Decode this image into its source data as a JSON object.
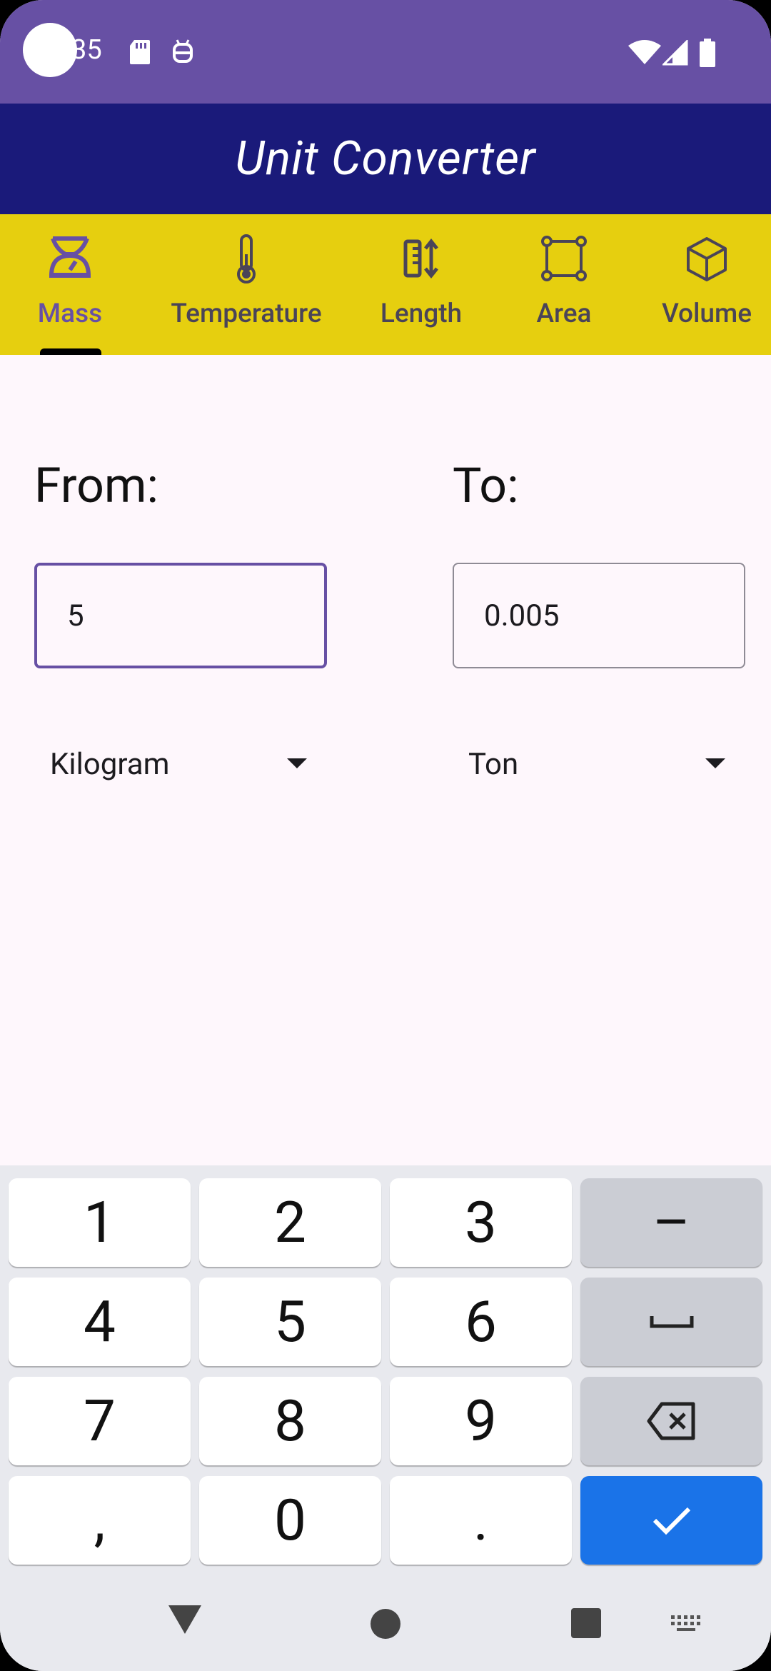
{
  "status_bar": {
    "time": "35"
  },
  "app_bar": {
    "title": "Unit Converter"
  },
  "tabs": [
    {
      "label": "Mass",
      "icon": "scale-icon",
      "selected": true
    },
    {
      "label": "Temperature",
      "icon": "thermometer-icon",
      "selected": false
    },
    {
      "label": "Length",
      "icon": "ruler-icon",
      "selected": false
    },
    {
      "label": "Area",
      "icon": "area-icon",
      "selected": false
    },
    {
      "label": "Volume",
      "icon": "cube-icon",
      "selected": false
    }
  ],
  "converter": {
    "from_label": "From:",
    "to_label": "To:",
    "from_value": "5",
    "to_value": "0.005",
    "from_unit": "Kilogram",
    "to_unit": "Ton"
  },
  "keyboard": {
    "rows": [
      [
        "1",
        "2",
        "3",
        "–"
      ],
      [
        "4",
        "5",
        "6",
        "space"
      ],
      [
        "7",
        "8",
        "9",
        "backspace"
      ],
      [
        ",",
        "0",
        ".",
        "done"
      ]
    ]
  },
  "colors": {
    "status_bar": "#6750a4",
    "app_bar": "#1a1a7a",
    "tab_bar": "#e6cf0f",
    "accent": "#6750a4",
    "keyboard_action": "#1a73e8"
  }
}
